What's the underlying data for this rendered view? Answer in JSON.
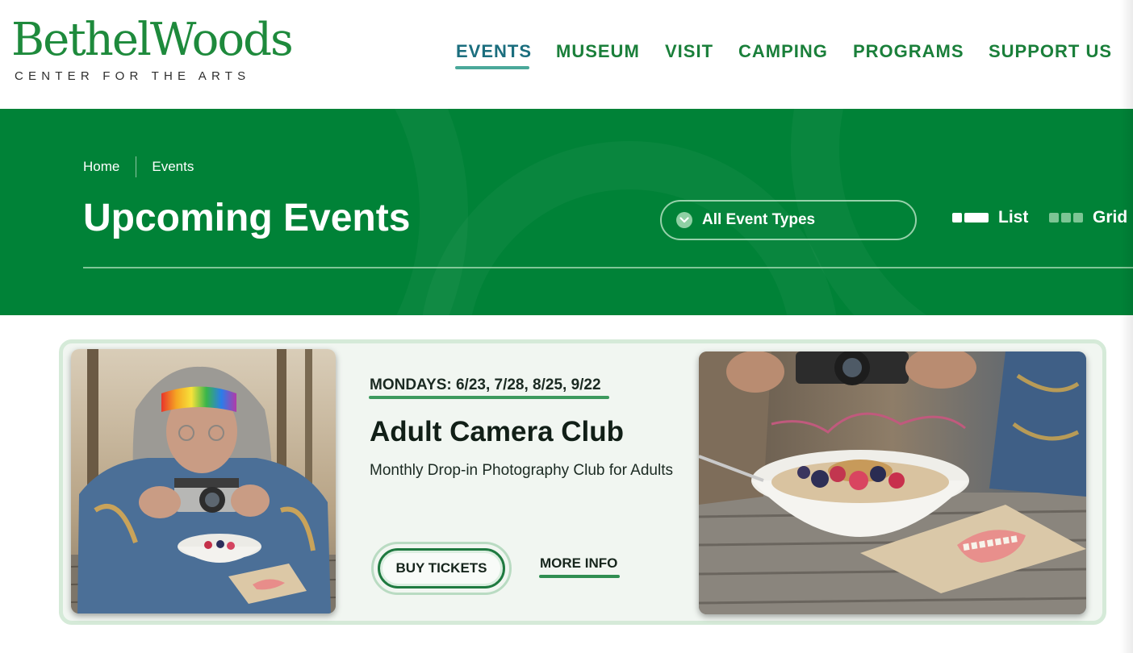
{
  "header": {
    "logo_main": "BethelWoods",
    "logo_sub": "CENTER FOR THE ARTS",
    "nav": [
      {
        "label": "EVENTS",
        "active": true
      },
      {
        "label": "MUSEUM",
        "active": false
      },
      {
        "label": "VISIT",
        "active": false
      },
      {
        "label": "CAMPING",
        "active": false
      },
      {
        "label": "PROGRAMS",
        "active": false
      },
      {
        "label": "SUPPORT US",
        "active": false
      }
    ]
  },
  "hero": {
    "breadcrumb": [
      "Home",
      "Events"
    ],
    "title": "Upcoming Events",
    "filter": {
      "label": "All Event Types",
      "icon": "chevron-down-icon"
    },
    "view_toggle": {
      "list_label": "List",
      "grid_label": "Grid",
      "selected": "List"
    }
  },
  "event": {
    "date": "MONDAYS: 6/23, 7/28, 8/25, 9/22",
    "title": "Adult Camera Club",
    "description": "Monthly Drop-in Photography Club for Adults",
    "buy_label": "BUY TICKETS",
    "more_label": "MORE INFO"
  },
  "colors": {
    "brand_green": "#008237",
    "nav_green": "#1a7f3a",
    "active_teal": "#1b6e7e",
    "card_bg": "#f1f6f1"
  }
}
